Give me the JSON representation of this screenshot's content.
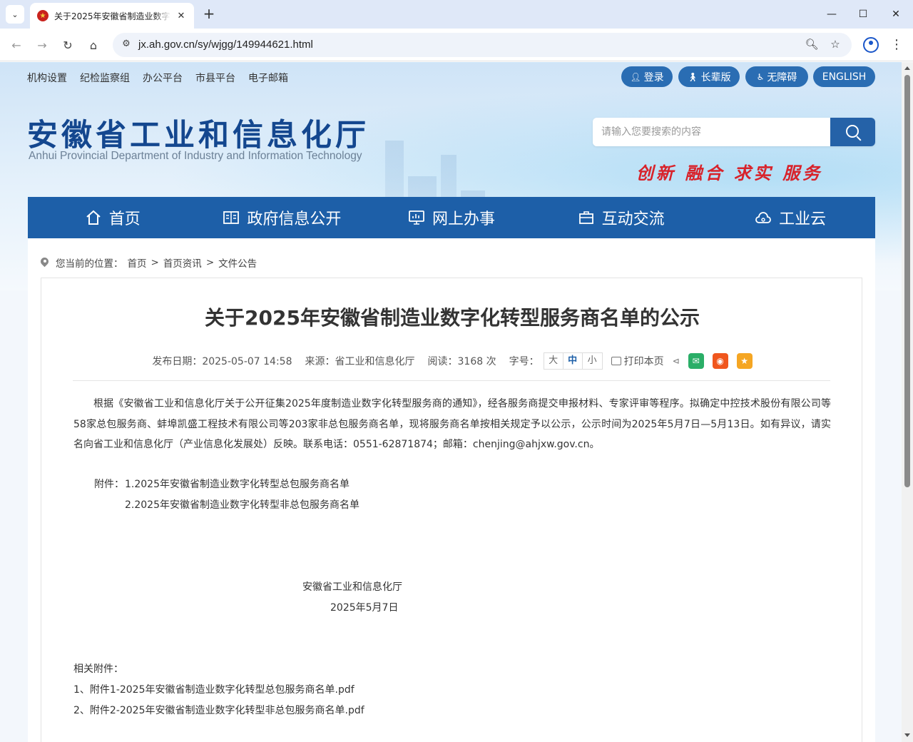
{
  "browser": {
    "tab_title": "关于2025年安徽省制造业数字化转型服务商名单的公示",
    "url": "jx.ah.gov.cn/sy/wjgg/149944621.html",
    "new_tab": "+",
    "tab_close": "✕",
    "tab_menu": "⌄",
    "win_min": "—",
    "win_max": "☐",
    "win_close": "✕"
  },
  "top_links": [
    "机构设置",
    "纪检监察组",
    "办公平台",
    "市县平台",
    "电子邮箱"
  ],
  "top_buttons": {
    "login": "登录",
    "elder": "长辈版",
    "accessible": "无障碍",
    "english": "ENGLISH"
  },
  "logo": {
    "cn": "安徽省工业和信息化厅",
    "en": "Anhui Provincial Department of Industry and Information Technology"
  },
  "search": {
    "placeholder": "请输入您要搜索的内容"
  },
  "slogan": "创新 融合 求实 服务",
  "nav": [
    "首页",
    "政府信息公开",
    "网上办事",
    "互动交流",
    "工业云"
  ],
  "breadcrumb": {
    "prefix": "您当前的位置：",
    "items": [
      "首页",
      "首页资讯",
      "文件公告"
    ],
    "sep": ">"
  },
  "article": {
    "title": "关于2025年安徽省制造业数字化转型服务商名单的公示",
    "date_label": "发布日期：2025-05-07 14:58",
    "source_label": "来源：省工业和信息化厅",
    "views_label": "阅读：3168 次",
    "font_label": "字号：",
    "font_sizes": [
      "大",
      "中",
      "小"
    ],
    "print_label": "打印本页",
    "body": "根据《安徽省工业和信息化厅关于公开征集2025年度制造业数字化转型服务商的通知》，经各服务商提交申报材料、专家评审等程序。拟确定中控技术股份有限公司等58家总包服务商、蚌埠凯盛工程技术有限公司等203家非总包服务商名单，现将服务商名单按相关规定予以公示，公示时间为2025年5月7日—5月13日。如有异议，请实名向省工业和信息化厅（产业信息化发展处）反映。联系电话：0551-62871874；邮箱：chenjing@ahjxw.gov.cn。",
    "attach_label": "附件：",
    "attach_1": "1.2025年安徽省制造业数字化转型总包服务商名单",
    "attach_2": "2.2025年安徽省制造业数字化转型非总包服务商名单",
    "signature_org": "安徽省工业和信息化厅",
    "signature_date": "2025年5月7日",
    "related_label": "相关附件：",
    "related": [
      "1、附件1-2025年安徽省制造业数字化转型总包服务商名单.pdf",
      "2、附件2-2025年安徽省制造业数字化转型非总包服务商名单.pdf"
    ]
  },
  "colors": {
    "nav_blue": "#1d5fa8",
    "pill_blue": "#2a6db3",
    "title_blue": "#14478f",
    "slogan_red": "#d8222a",
    "wechat_green": "#2aae67",
    "weibo_orange": "#f0561d",
    "favorite_orange": "#f5a623"
  }
}
